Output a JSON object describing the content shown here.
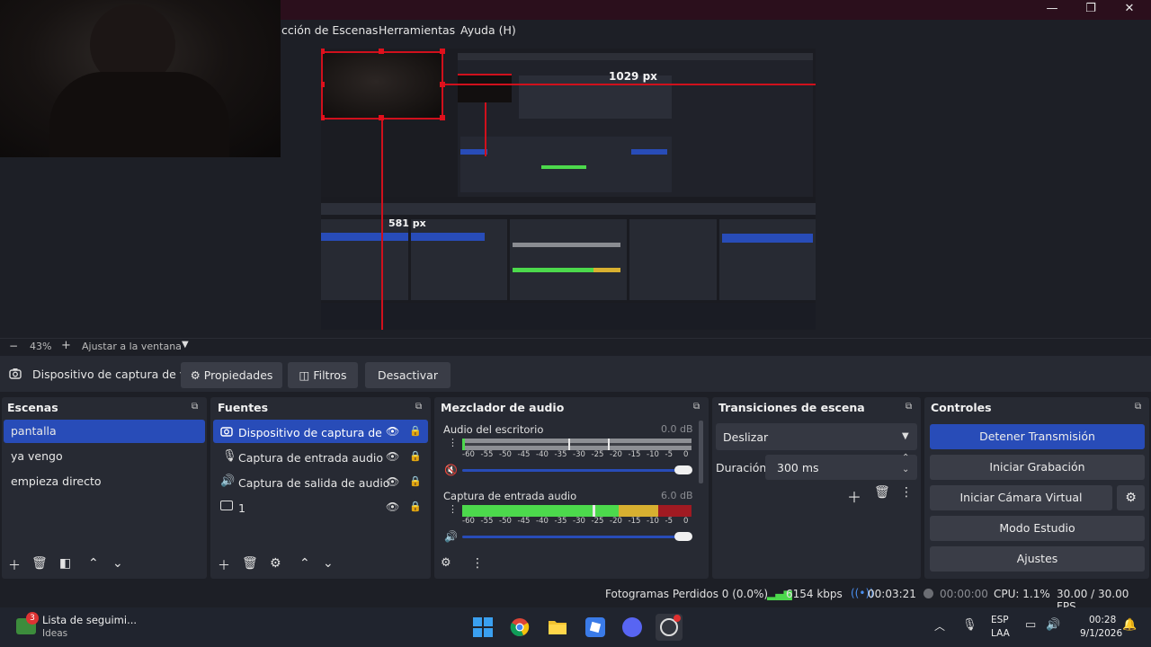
{
  "window": {
    "minimize": "—",
    "restore": "❐",
    "close": "✕"
  },
  "menu": [
    "cción de Escenas",
    "Herramientas",
    "Ayuda (H)"
  ],
  "preview": {
    "measure_h": "1029 px",
    "measure_v": "581 px"
  },
  "zoom": {
    "minus": "−",
    "value": "43%",
    "plus": "+",
    "fit": "Ajustar a la ventana"
  },
  "source_toolbar": {
    "source_name": "Dispositivo de captura de v",
    "properties": "Propiedades",
    "filters": "Filtros",
    "deactivate": "Desactivar"
  },
  "scenes": {
    "title": "Escenas",
    "items": [
      "pantalla",
      "ya vengo",
      "empieza directo"
    ]
  },
  "sources": {
    "title": "Fuentes",
    "items": [
      "Dispositivo de captura de vi",
      "Captura de entrada audio",
      "Captura de salida de audio",
      "1"
    ]
  },
  "mixer": {
    "title": "Mezclador de audio",
    "channels": [
      {
        "name": "Audio del escritorio",
        "db": "0.0 dB",
        "level": 0.0
      },
      {
        "name": "Captura de entrada audio",
        "db": "6.0 dB",
        "level": 0.82
      }
    ],
    "ticks": [
      "-60",
      "-55",
      "-50",
      "-45",
      "-40",
      "-35",
      "-30",
      "-25",
      "-20",
      "-15",
      "-10",
      "-5",
      "0"
    ]
  },
  "transitions": {
    "title": "Transiciones de escena",
    "selected": "Deslizar",
    "duration_label": "Duración",
    "duration_value": "300 ms"
  },
  "controls": {
    "title": "Controles",
    "stop_stream": "Detener Transmisión",
    "start_recording": "Iniciar Grabación",
    "start_virtual_cam": "Iniciar Cámara Virtual",
    "studio_mode": "Modo Estudio",
    "settings": "Ajustes"
  },
  "status": {
    "dropped_frames": "Fotogramas Perdidos 0 (0.0%)",
    "bitrate": "6154 kbps",
    "stream_time": "00:03:21",
    "rec_time": "00:00:00",
    "cpu": "CPU: 1.1%",
    "fps": "30.00 / 30.00 FPS"
  },
  "taskbar": {
    "widget_title": "Lista de seguimi...",
    "widget_sub": "Ideas",
    "widget_badge": "3",
    "lang_1": "ESP",
    "lang_2": "LAA",
    "time": "00:28",
    "date": "9/1/2026"
  },
  "colors": {
    "accent": "#284cb8",
    "panel": "#272a33",
    "background": "#1d1f26",
    "meter_green": "#4cd94c",
    "meter_yellow": "#d8b030",
    "meter_red": "#a01a22",
    "measure_red": "#d0101c"
  }
}
